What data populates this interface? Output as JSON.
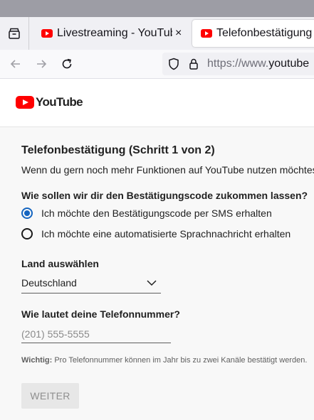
{
  "browser": {
    "tabs": [
      {
        "title": "Livestreaming - YouTube",
        "close": "×"
      },
      {
        "title": "Telefonbestätigung"
      }
    ],
    "url_dim": "https://www.",
    "url_host": "youtube"
  },
  "youtube": {
    "logo_text": "YouTube"
  },
  "verification": {
    "title": "Telefonbestätigung (Schritt 1 von 2)",
    "intro": "Wenn du gern noch mehr Funktionen auf YouTube nutzen möchtest",
    "method_question": "Wie sollen wir dir den Bestätigungscode zukommen lassen?",
    "options": [
      {
        "label": "Ich möchte den Bestätigungscode per SMS erhalten",
        "selected": true
      },
      {
        "label": "Ich möchte eine automatisierte Sprachnachricht erhalten",
        "selected": false
      }
    ],
    "country_label": "Land auswählen",
    "country_value": "Deutschland",
    "phone_label": "Wie lautet deine Telefonnummer?",
    "phone_placeholder": "(201) 555-5555",
    "phone_value": "",
    "note_bold": "Wichtig:",
    "note_text": " Pro Telefonnummer können im Jahr bis zu zwei Kanäle bestätigt werden.",
    "submit_label": "WEITER"
  },
  "colors": {
    "youtube_red": "#ff0000",
    "radio_selected": "#1565c0",
    "titlebar": "#9d9da5"
  }
}
